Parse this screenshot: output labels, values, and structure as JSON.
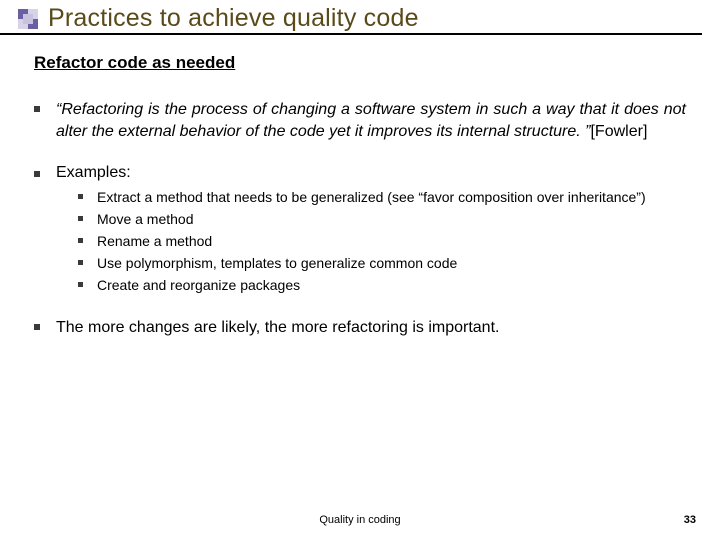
{
  "title": "Practices to achieve quality code",
  "subtitle": "Refactor code as needed",
  "bullets": [
    {
      "quote": "“Refactoring is the process of changing a software system in such a way that it does not alter the external behavior of the code yet it improves its internal structure. ”",
      "attribution": "[Fowler]"
    },
    {
      "label": "Examples:",
      "items": [
        "Extract a method that needs to be generalized (see “favor composition over inheritance”)",
        "Move a method",
        "Rename a method",
        "Use polymorphism, templates to generalize common code",
        "Create and reorganize packages"
      ]
    },
    {
      "text": "The more changes are likely, the more refactoring is important."
    }
  ],
  "footer": "Quality in coding",
  "page": "33"
}
